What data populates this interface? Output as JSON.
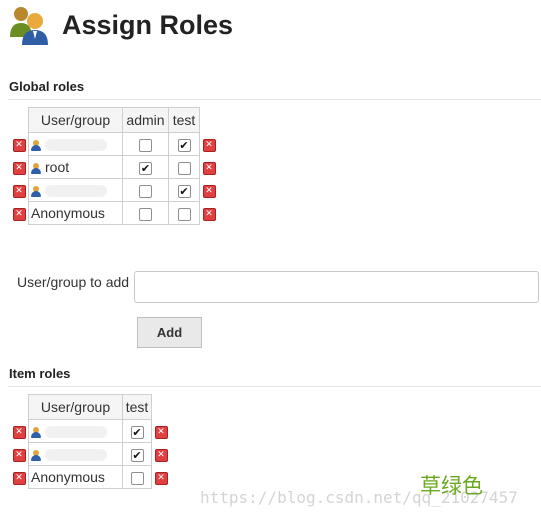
{
  "page": {
    "title": "Assign Roles"
  },
  "global_roles": {
    "title": "Global roles",
    "columns": [
      "User/group",
      "admin",
      "test"
    ],
    "rows": [
      {
        "name": "",
        "redacted": true,
        "user_icon": true,
        "admin": false,
        "test": true
      },
      {
        "name": "root",
        "redacted": false,
        "user_icon": true,
        "admin": true,
        "test": false
      },
      {
        "name": "",
        "redacted": true,
        "user_icon": true,
        "admin": false,
        "test": true
      },
      {
        "name": "Anonymous",
        "redacted": false,
        "user_icon": false,
        "admin": false,
        "test": false
      }
    ]
  },
  "add_user": {
    "label": "User/group to add",
    "value": "",
    "placeholder": "",
    "button_label": "Add"
  },
  "item_roles": {
    "title": "Item roles",
    "columns": [
      "User/group",
      "test"
    ],
    "rows": [
      {
        "name": "",
        "redacted": true,
        "user_icon": true,
        "test": true
      },
      {
        "name": "",
        "redacted": true,
        "user_icon": true,
        "test": true
      },
      {
        "name": "Anonymous",
        "redacted": false,
        "user_icon": false,
        "test": false
      }
    ]
  },
  "watermark": {
    "url": "https://blog.csdn.net/qq_21027457",
    "caption": "草绿色"
  },
  "icons": {
    "header": "users-roles-icon",
    "delete": "delete-icon",
    "user": "user-icon"
  },
  "colors": {
    "delete_red": "#e04040",
    "user_head": "#e2a43a",
    "user_body": "#2e5fa8",
    "watermark_green": "#6aa81f"
  }
}
